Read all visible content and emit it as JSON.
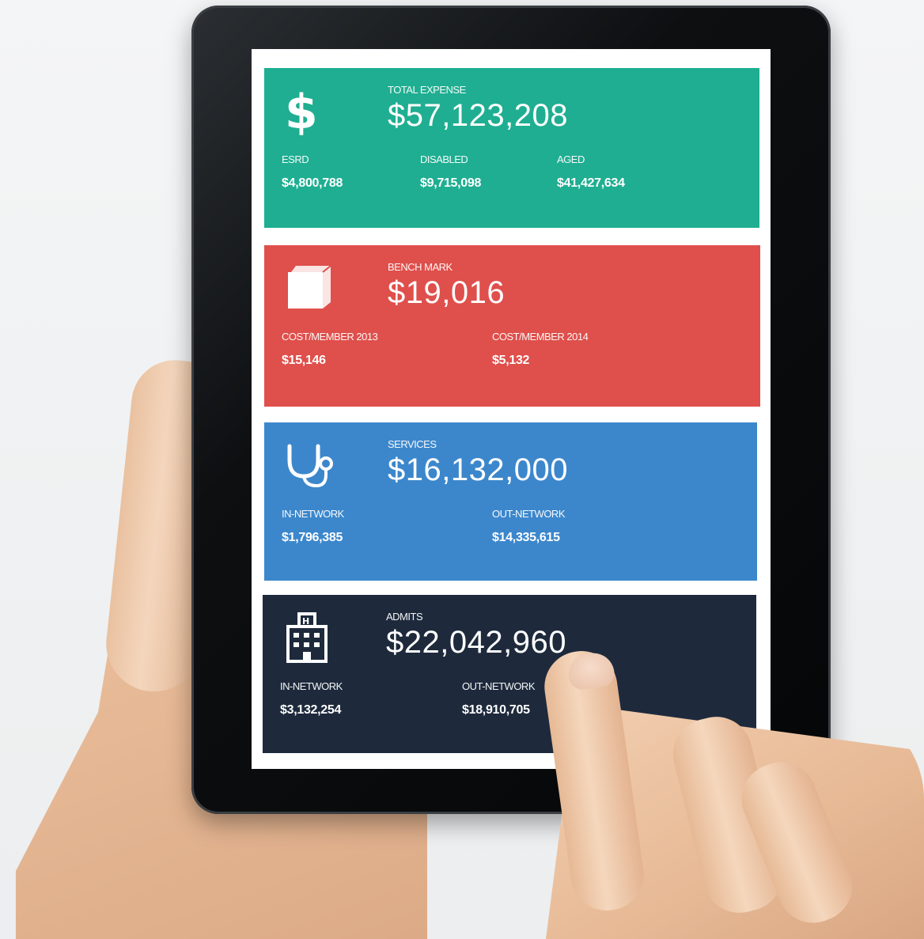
{
  "colors": {
    "expense": "#1fae91",
    "benchmark": "#df4f4b",
    "services": "#3c87cc",
    "admits": "#1e2a3c"
  },
  "cards": {
    "expense": {
      "icon": "dollar-icon",
      "label": "TOTAL EXPENSE",
      "value": "$57,123,208",
      "stats": [
        {
          "label": "ESRD",
          "value": "$4,800,788"
        },
        {
          "label": "DISABLED",
          "value": "$9,715,098"
        },
        {
          "label": "AGED",
          "value": "$41,427,634"
        }
      ]
    },
    "benchmark": {
      "icon": "book-icon",
      "label": "BENCH MARK",
      "value": "$19,016",
      "stats": [
        {
          "label": "COST/MEMBER 2013",
          "value": "$15,146"
        },
        {
          "label": "COST/MEMBER 2014",
          "value": "$5,132"
        }
      ]
    },
    "services": {
      "icon": "stethoscope-icon",
      "label": "SERVICES",
      "value": "$16,132,000",
      "stats": [
        {
          "label": "IN-NETWORK",
          "value": "$1,796,385"
        },
        {
          "label": "OUT-NETWORK",
          "value": "$14,335,615"
        }
      ]
    },
    "admits": {
      "icon": "hospital-icon",
      "label": "ADMITS",
      "value": "$22,042,960",
      "stats": [
        {
          "label": "IN-NETWORK",
          "value": "$3,132,254"
        },
        {
          "label": "OUT-NETWORK",
          "value": "$18,910,705"
        }
      ]
    }
  }
}
